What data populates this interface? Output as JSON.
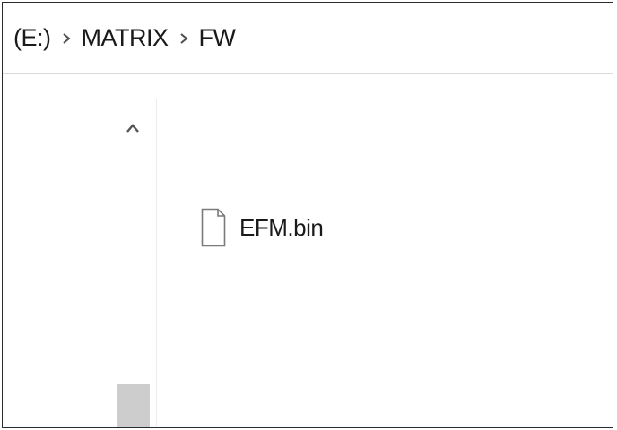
{
  "breadcrumb": {
    "items": [
      {
        "label": "(E:)"
      },
      {
        "label": "MATRIX"
      },
      {
        "label": "FW"
      }
    ],
    "separator_icon": "chevron-right-icon"
  },
  "nav_pane": {
    "scroll_up_icon": "chevron-up-icon"
  },
  "files": [
    {
      "name": "EFM.bin",
      "icon": "file-icon"
    }
  ],
  "colors": {
    "border": "#2b2b2b",
    "divider": "#d9d9d9",
    "scroll_thumb": "#cdcdcd",
    "text": "#1a1a1a"
  }
}
